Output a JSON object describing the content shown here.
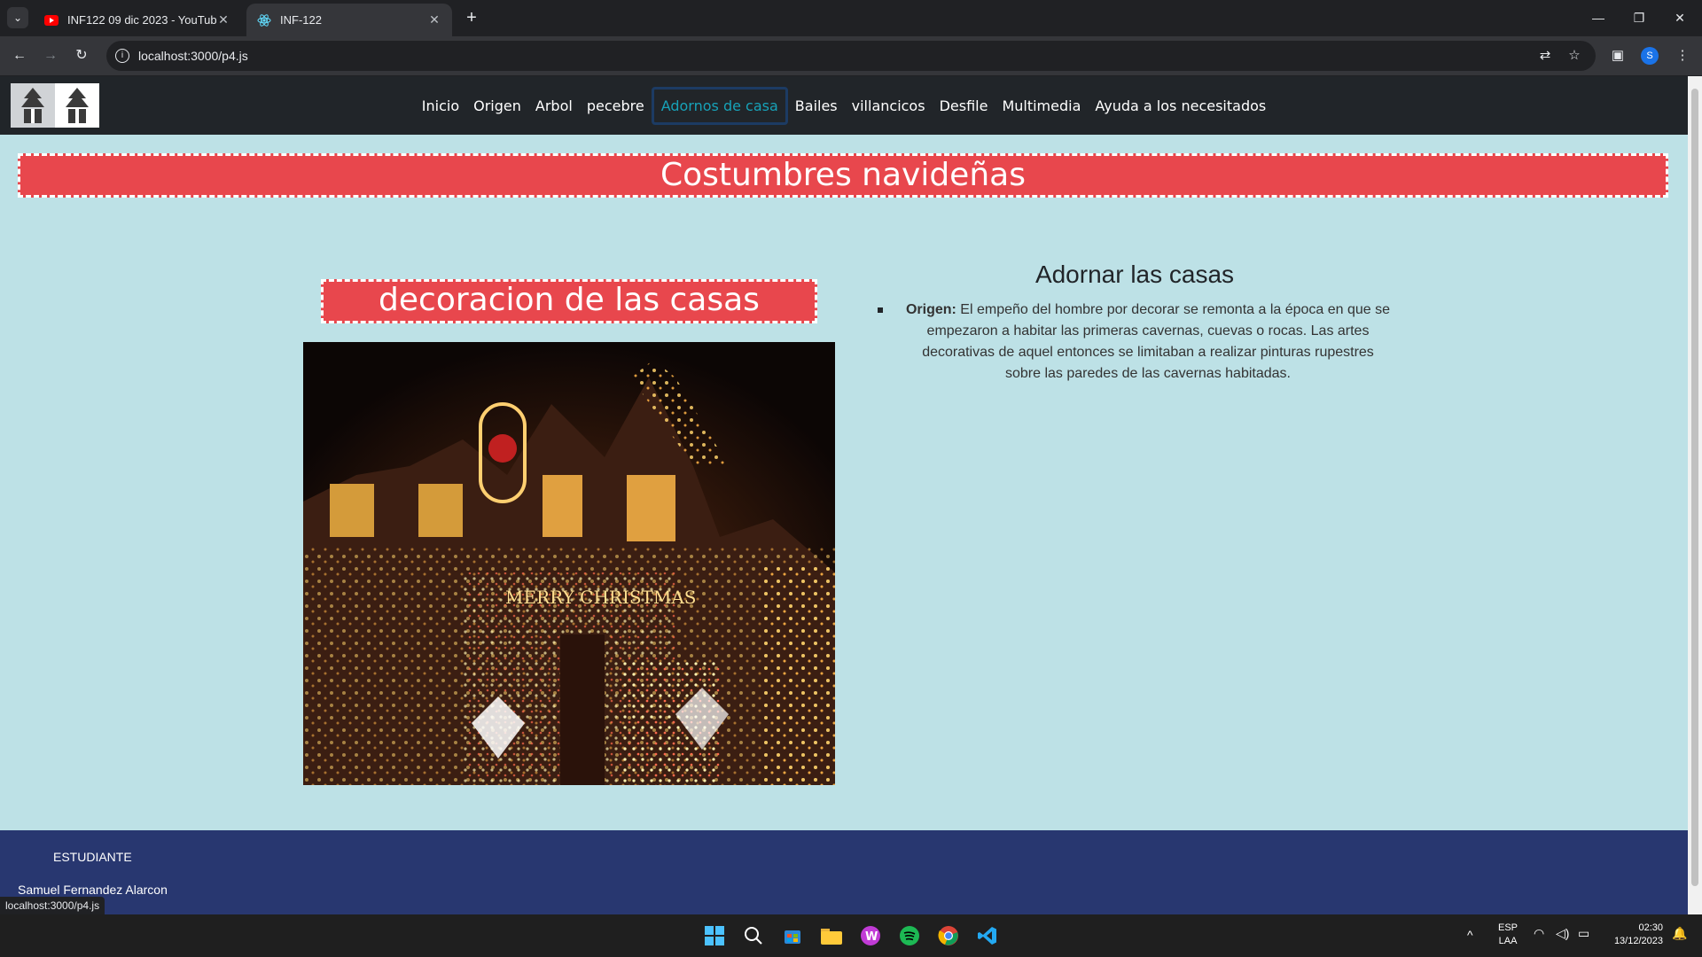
{
  "browser": {
    "tabs": [
      {
        "title": "INF122 09 dic 2023 - YouTube",
        "favicon": "youtube-icon"
      },
      {
        "title": "INF-122",
        "favicon": "react-icon"
      }
    ],
    "url": "localhost:3000/p4.js",
    "status_url": "localhost:3000/p4.js",
    "profile_initial": "S"
  },
  "site": {
    "nav": [
      {
        "label": "Inicio"
      },
      {
        "label": "Origen"
      },
      {
        "label": "Arbol"
      },
      {
        "label": "pecebre"
      },
      {
        "label": "Adornos de casa",
        "active": true
      },
      {
        "label": "Bailes"
      },
      {
        "label": "villancicos"
      },
      {
        "label": "Desfile"
      },
      {
        "label": "Multimedia"
      },
      {
        "label": "Ayuda a los necesitados"
      }
    ],
    "main_title": "Costumbres navideñas",
    "section_title": "decoracion de las casas",
    "right_heading": "Adornar las casas",
    "origin_label": "Origen:",
    "origin_text": "El empeño del hombre por decorar se remonta a la época en que se empezaron a habitar las primeras cavernas, cuevas o rocas. Las artes decorativas de aquel entonces se limitaban a realizar pinturas rupestres sobre las paredes de las cavernas habitadas.",
    "footer_label": "ESTUDIANTE",
    "footer_name": "Samuel Fernandez Alarcon"
  },
  "taskbar": {
    "lang_top": "ESP",
    "lang_bottom": "LAA",
    "time": "02:30",
    "date": "13/12/2023"
  },
  "colors": {
    "banner": "#e8474d",
    "page_bg": "#bde1e6",
    "nav_bg": "#212529",
    "footer_bg": "#283770",
    "active_link": "#17a2b8"
  }
}
